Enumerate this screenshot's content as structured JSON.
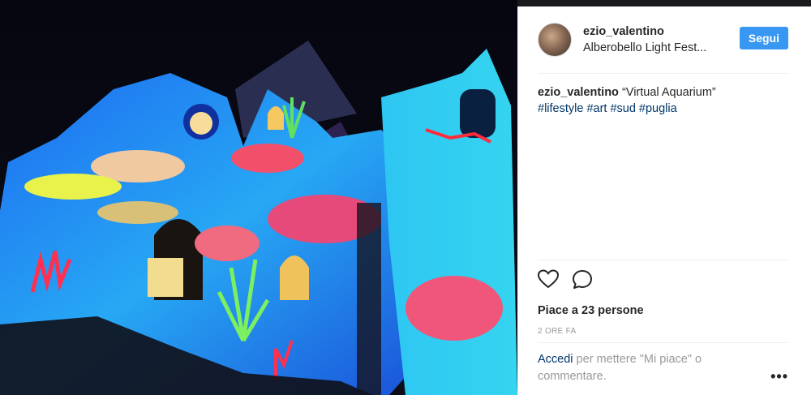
{
  "post": {
    "username": "ezio_valentino",
    "location": "Alberobello Light Fest...",
    "follow_label": "Segui",
    "caption_user": "ezio_valentino",
    "caption_text": "“Virtual Aquarium”",
    "hashtags": "#lifestyle #art #sud #puglia",
    "likes": "Piace a 23 persone",
    "time": "2 ORE FA",
    "login_link": "Accedi",
    "login_rest": " per mettere \"Mi piace\" o commentare.",
    "more_label": "•••"
  },
  "icons": {
    "like": "heart-icon",
    "comment": "comment-bubble-icon",
    "more": "more-options-icon"
  },
  "colors": {
    "accent": "#3897f0",
    "link": "#003569",
    "text": "#262626",
    "muted": "#999999"
  }
}
